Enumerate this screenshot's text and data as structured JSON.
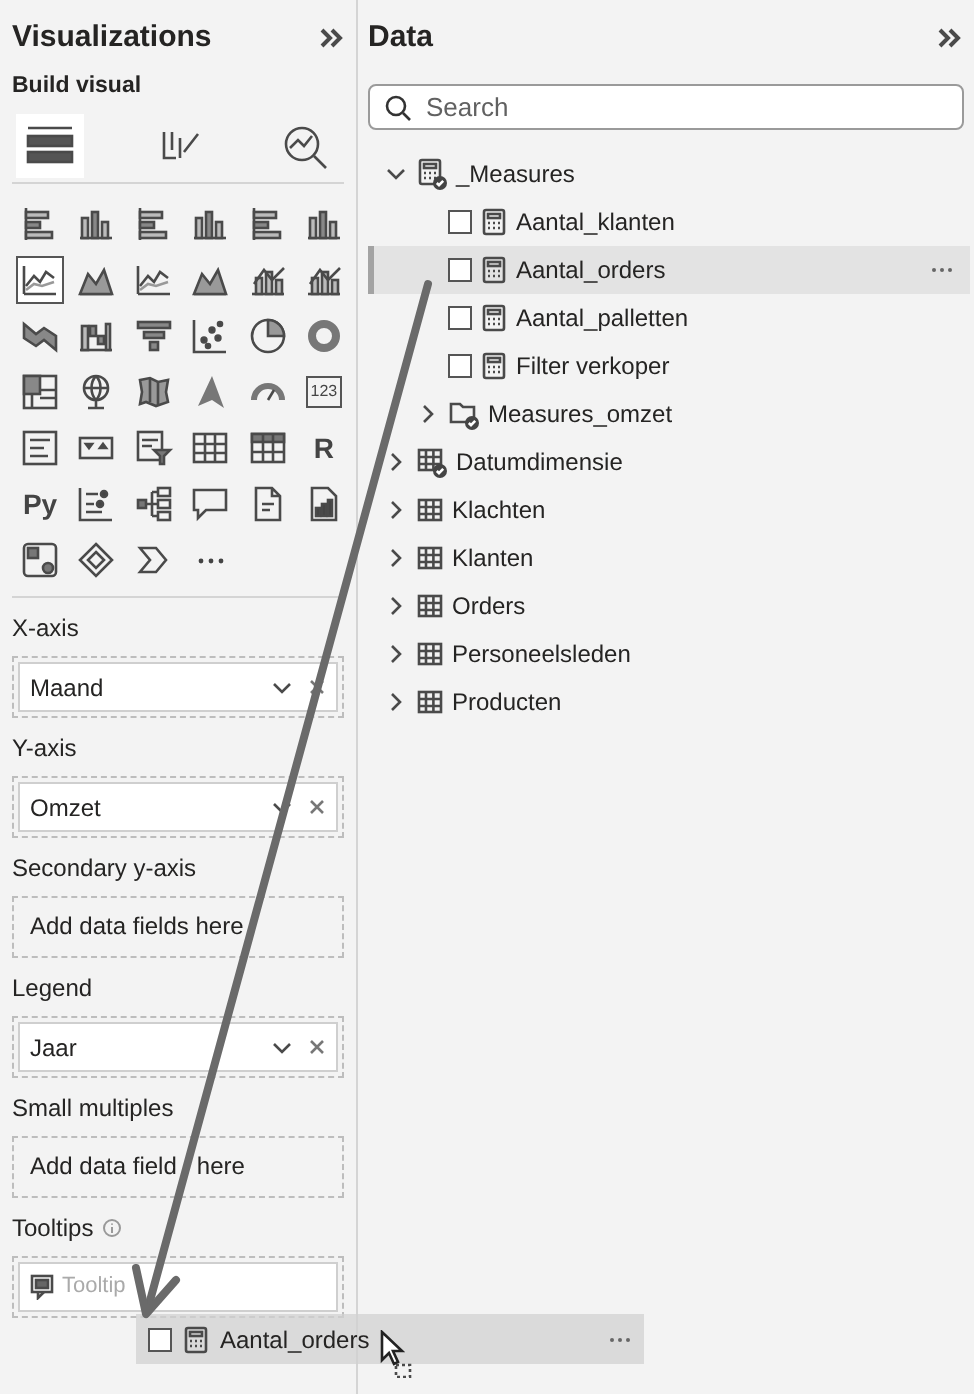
{
  "visualizations": {
    "title": "Visualizations",
    "subtitle": "Build visual",
    "build_tabs": [
      {
        "selected": true
      },
      {
        "selected": false
      },
      {
        "selected": false
      }
    ],
    "gallery": [
      {
        "selected": false
      },
      {
        "selected": false
      },
      {
        "selected": false
      },
      {
        "selected": false
      },
      {
        "selected": false
      },
      {
        "selected": false
      },
      {
        "selected": true
      },
      {
        "selected": false
      },
      {
        "selected": false
      },
      {
        "selected": false
      },
      {
        "selected": false
      },
      {
        "selected": false
      },
      {
        "selected": false
      },
      {
        "selected": false
      },
      {
        "selected": false
      },
      {
        "selected": false
      },
      {
        "selected": false
      },
      {
        "selected": false
      },
      {
        "selected": false
      },
      {
        "selected": false
      },
      {
        "selected": false
      },
      {
        "selected": false
      },
      {
        "selected": false
      },
      {
        "label": "123",
        "selected": false
      },
      {
        "selected": false
      },
      {
        "selected": false
      },
      {
        "selected": false
      },
      {
        "selected": false
      },
      {
        "selected": false
      },
      {
        "label": "R",
        "selected": false
      },
      {
        "label": "Py",
        "selected": false
      },
      {
        "selected": false
      },
      {
        "selected": false
      },
      {
        "selected": false
      },
      {
        "selected": false
      },
      {
        "selected": false
      },
      {
        "selected": false
      },
      {
        "selected": false
      },
      {
        "selected": false
      },
      {
        "selected": false
      }
    ],
    "wells": [
      {
        "label": "X-axis",
        "kind": "field",
        "value": "Maand"
      },
      {
        "label": "Y-axis",
        "kind": "field",
        "value": "Omzet"
      },
      {
        "label": "Secondary y-axis",
        "kind": "empty",
        "hint": [
          "Add data fields here"
        ]
      },
      {
        "label": "Legend",
        "kind": "field",
        "value": "Jaar"
      },
      {
        "label": "Small multiples",
        "kind": "empty",
        "hint": [
          "Add data field",
          "here"
        ]
      },
      {
        "label": "Tooltips",
        "kind": "tooltip",
        "hint": "Tooltip"
      }
    ]
  },
  "data_pane": {
    "title": "Data",
    "search": {
      "placeholder": "Search"
    },
    "tree": [
      {
        "label": "_Measures",
        "kind": "measure-table",
        "expanded": true,
        "children": [
          {
            "label": "Aantal_klanten",
            "kind": "measure",
            "checked": false,
            "selected": false
          },
          {
            "label": "Aantal_orders",
            "kind": "measure",
            "checked": false,
            "selected": true
          },
          {
            "label": "Aantal_palletten",
            "kind": "measure",
            "checked": false,
            "selected": false
          },
          {
            "label": "Filter verkoper",
            "kind": "measure",
            "checked": false,
            "selected": false
          },
          {
            "label": "Measures_omzet",
            "kind": "folder",
            "expanded": false
          }
        ]
      },
      {
        "label": "Datumdimensie",
        "kind": "date-table",
        "expanded": false
      },
      {
        "label": "Klachten",
        "kind": "table",
        "expanded": false
      },
      {
        "label": "Klanten",
        "kind": "table",
        "expanded": false
      },
      {
        "label": "Orders",
        "kind": "table",
        "expanded": false
      },
      {
        "label": "Personeelsleden",
        "kind": "table",
        "expanded": false
      },
      {
        "label": "Producten",
        "kind": "table",
        "expanded": false
      }
    ]
  },
  "drag_preview": {
    "label": "Aantal_orders",
    "checked": false
  }
}
